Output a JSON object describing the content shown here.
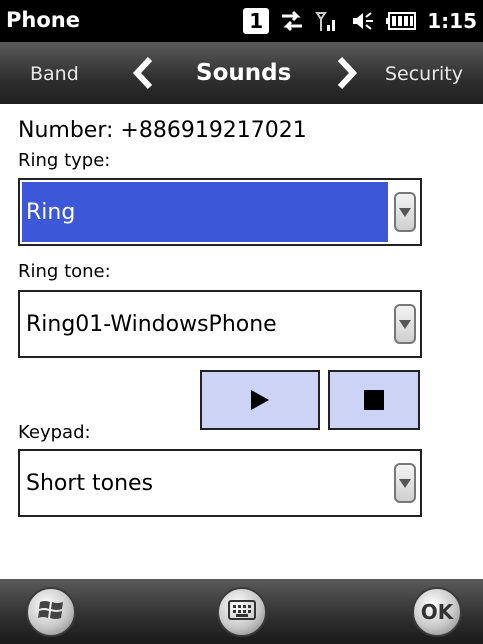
{
  "status_bar": {
    "app_title": "Phone",
    "sim_slot": "1",
    "time": "1:15"
  },
  "tabs": {
    "previous": "Band",
    "current": "Sounds",
    "next": "Security"
  },
  "form": {
    "number_line": "Number: +886919217021",
    "ring_type_label": "Ring type:",
    "ring_type_value": "Ring",
    "ring_tone_label": "Ring tone:",
    "ring_tone_value": "Ring01-WindowsPhone",
    "keypad_label": "Keypad:",
    "keypad_value": "Short tones"
  },
  "bottom_bar": {
    "ok_label": "OK"
  },
  "icons": [
    "sync-icon",
    "signal-icon",
    "speaker-icon",
    "battery-icon",
    "chevron-left-icon",
    "chevron-right-icon",
    "play-icon",
    "stop-icon",
    "windows-start-icon",
    "keyboard-icon"
  ],
  "colors": {
    "selection": "#3c57d8",
    "media_button": "#cdd3f5"
  }
}
